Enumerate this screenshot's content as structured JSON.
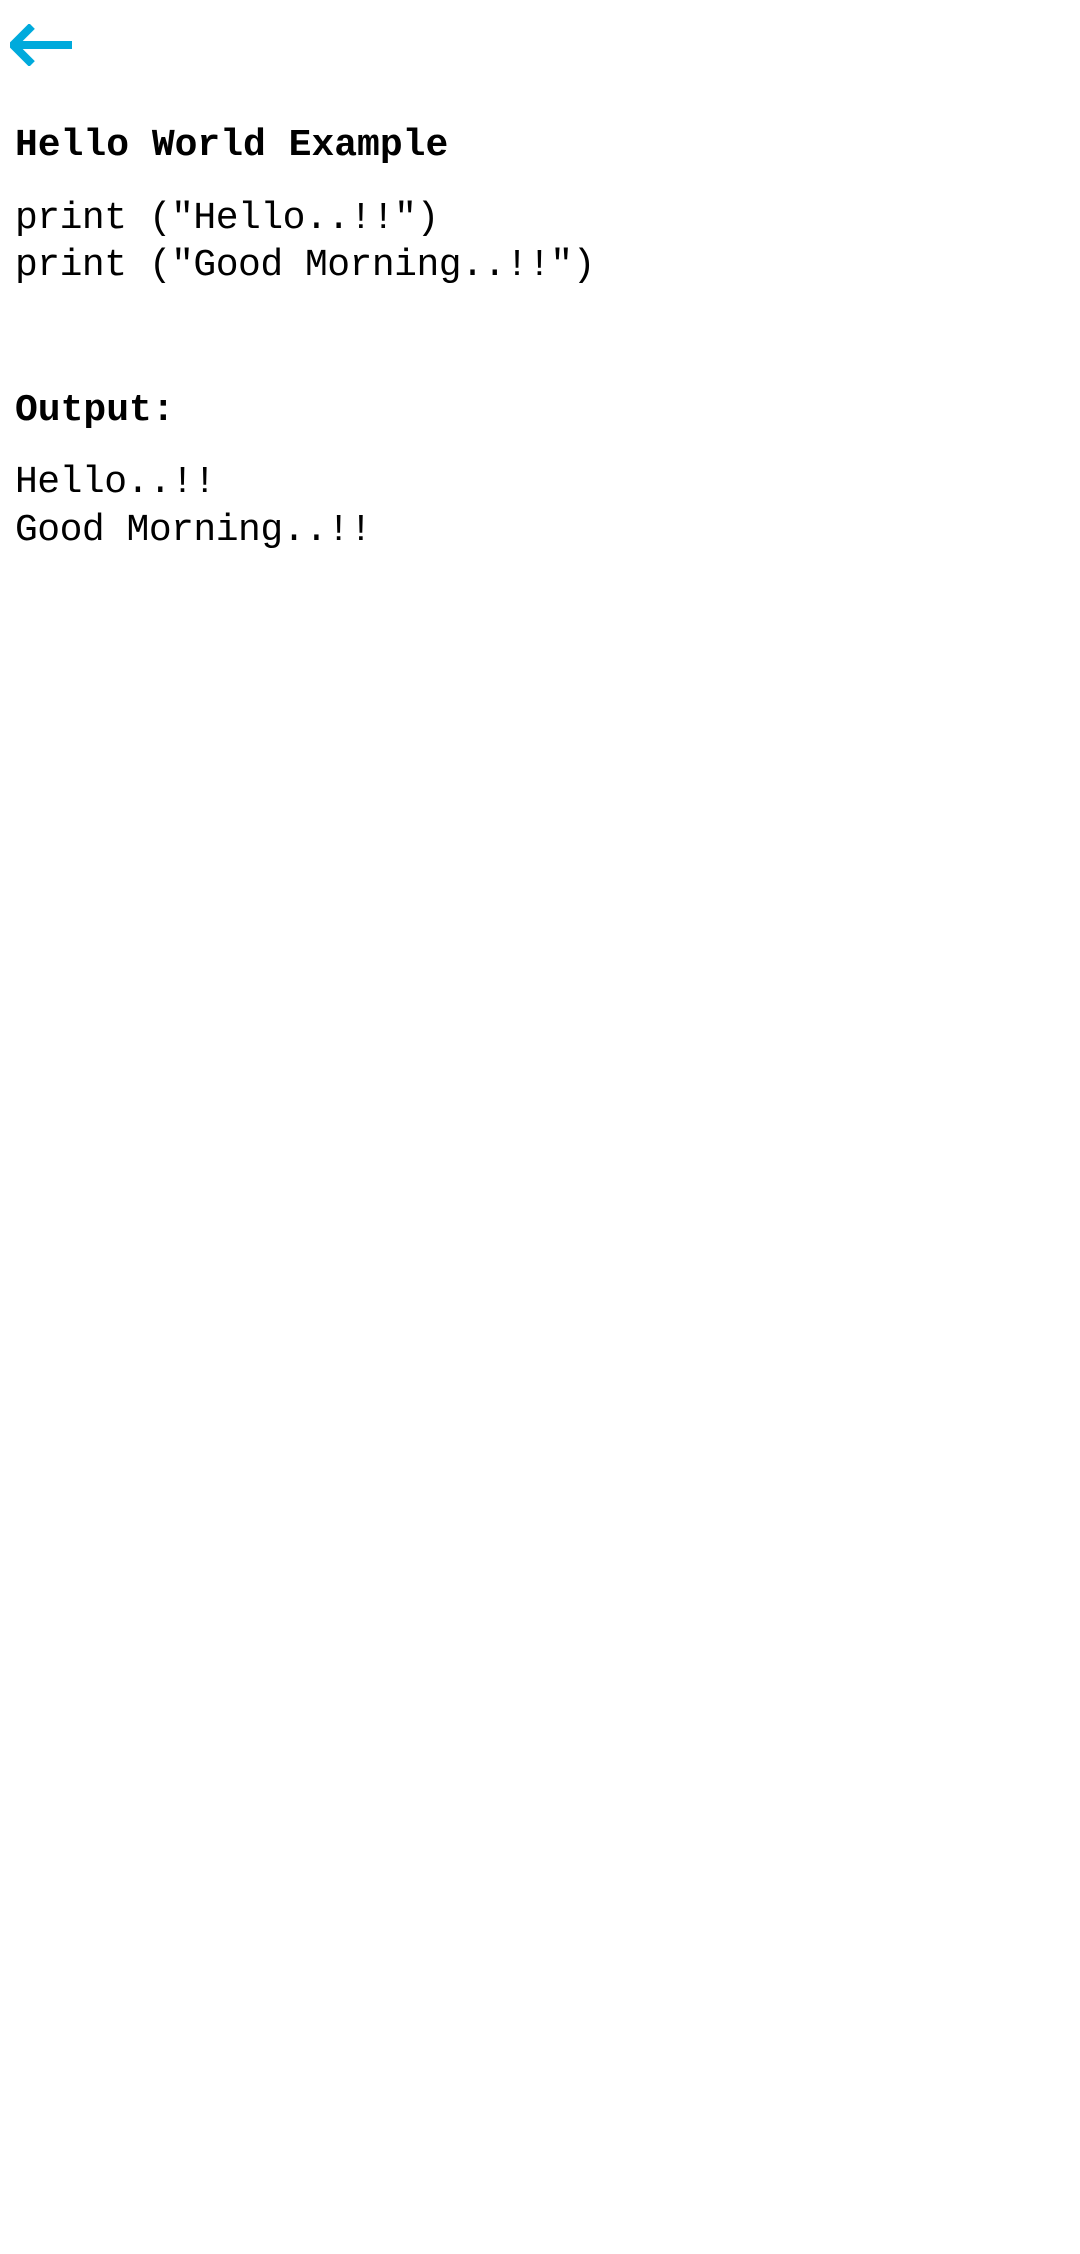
{
  "header": {
    "icon_color": "#00aadc"
  },
  "content": {
    "title": "Hello World Example",
    "code_lines": [
      "print (\"Hello..!!\")",
      "print (\"Good Morning..!!\")"
    ],
    "output_title": "Output:",
    "output_lines": [
      "Hello..!!",
      "Good Morning..!!"
    ]
  }
}
